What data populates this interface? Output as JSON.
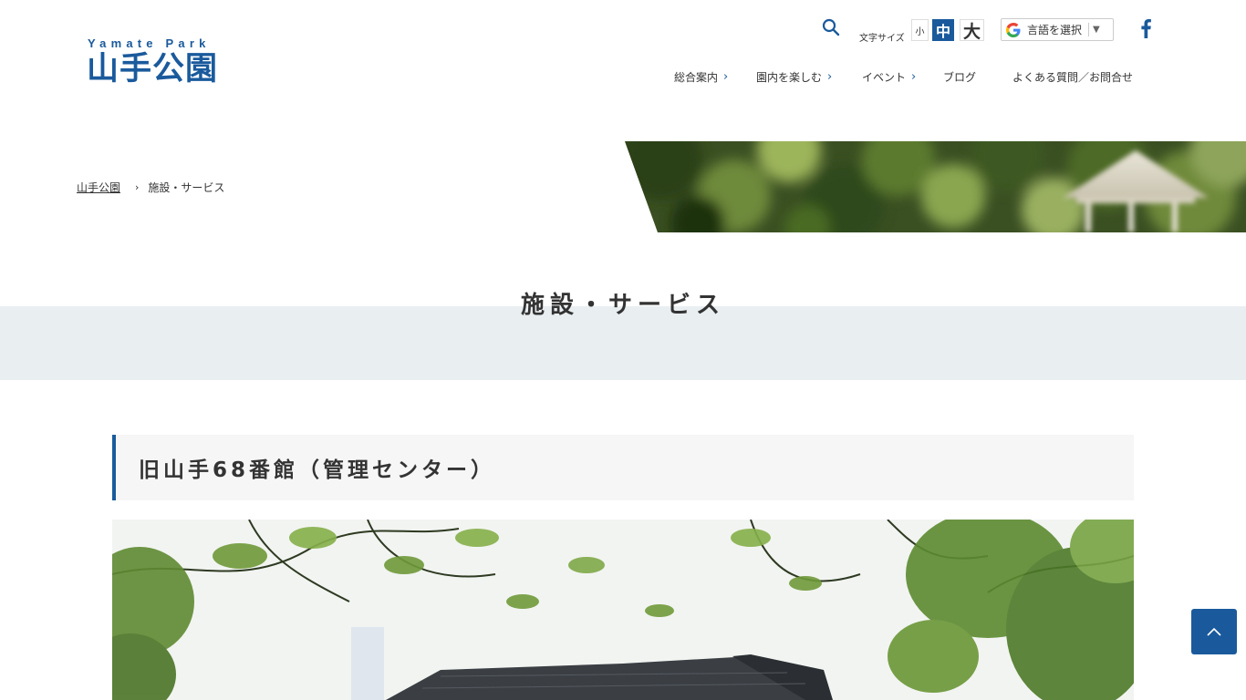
{
  "header": {
    "logo_en": "Yamate Park",
    "logo_jp": "山手公園",
    "font_size_label": "文字サイズ",
    "font_sizes": {
      "small": "小",
      "medium": "中",
      "large": "大",
      "selected": "medium"
    },
    "language_select": {
      "label": "言語を選択",
      "arrow": "▼"
    },
    "icons": {
      "search": "search-icon",
      "google": "google-g-icon",
      "facebook": "facebook-icon"
    }
  },
  "nav": {
    "items": [
      {
        "label": "総合案内",
        "has_chevron": true
      },
      {
        "label": "園内を楽しむ",
        "has_chevron": true
      },
      {
        "label": "イベント",
        "has_chevron": true
      },
      {
        "label": "ブログ",
        "has_chevron": false
      },
      {
        "label": "よくある質問／お問合せ",
        "has_chevron": false
      }
    ],
    "chevron": "›"
  },
  "breadcrumb": {
    "home": "山手公園",
    "separator": "›",
    "current": "施設・サービス"
  },
  "page": {
    "title": "施設・サービス",
    "section_heading": "旧山手68番館（管理センター）"
  },
  "colors": {
    "brand_blue": "#1a5a9c",
    "band_gray": "#e9eef1",
    "heading_bg": "#f6f6f6"
  }
}
